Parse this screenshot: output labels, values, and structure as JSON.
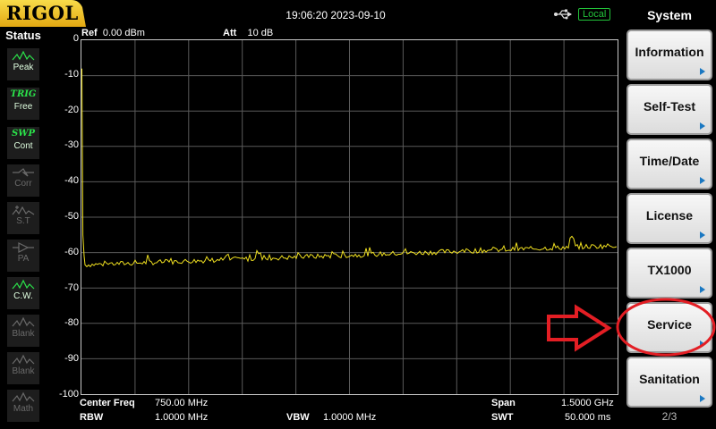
{
  "header": {
    "brand": "RIGOL",
    "datetime": "19:06:20 2023-09-10",
    "usb_icon": "usb-icon",
    "remote_mode": "Local"
  },
  "status": {
    "title": "Status",
    "items": [
      {
        "top": "",
        "bottom": "Peak",
        "icon": "peak-icon",
        "active": true
      },
      {
        "top": "TRIG",
        "bottom": "Free",
        "icon": "",
        "active": true
      },
      {
        "top": "SWP",
        "bottom": "Cont",
        "icon": "",
        "active": true
      },
      {
        "top": "",
        "bottom": "Corr",
        "icon": "corr-icon",
        "active": false
      },
      {
        "top": "",
        "bottom": "S.T",
        "icon": "st-icon",
        "active": false
      },
      {
        "top": "",
        "bottom": "PA",
        "icon": "pa-icon",
        "active": false
      },
      {
        "top": "",
        "bottom": "C.W.",
        "icon": "cw-icon",
        "active": true
      },
      {
        "top": "",
        "bottom": "Blank",
        "icon": "blank-icon",
        "active": false
      },
      {
        "top": "",
        "bottom": "Blank",
        "icon": "blank-icon",
        "active": false
      },
      {
        "top": "",
        "bottom": "Math",
        "icon": "math-icon",
        "active": false
      }
    ]
  },
  "plot": {
    "ref": "Ref",
    "ref_value": "0.00 dBm",
    "att": "Att",
    "att_value": "10 dB",
    "y_ticks": [
      "0",
      "-10",
      "-20",
      "-30",
      "-40",
      "-50",
      "-60",
      "-70",
      "-80",
      "-90",
      "-100"
    ],
    "trace_color": "#f0e020",
    "grid_color": "#5a5a5a"
  },
  "footer": {
    "center_freq_label": "Center Freq",
    "center_freq_value": "750.00 MHz",
    "rbw_label": "RBW",
    "rbw_value": "1.0000 MHz",
    "vbw_label": "VBW",
    "vbw_value": "1.0000 MHz",
    "span_label": "Span",
    "span_value": "1.5000 GHz",
    "swt_label": "SWT",
    "swt_value": "50.000 ms"
  },
  "menu": {
    "title": "System",
    "softkeys": [
      "Information",
      "Self-Test",
      "Time/Date",
      "License",
      "TX1000",
      "Service",
      "Sanitation"
    ],
    "page": "2/3",
    "highlight_color": "#e31e24"
  }
}
